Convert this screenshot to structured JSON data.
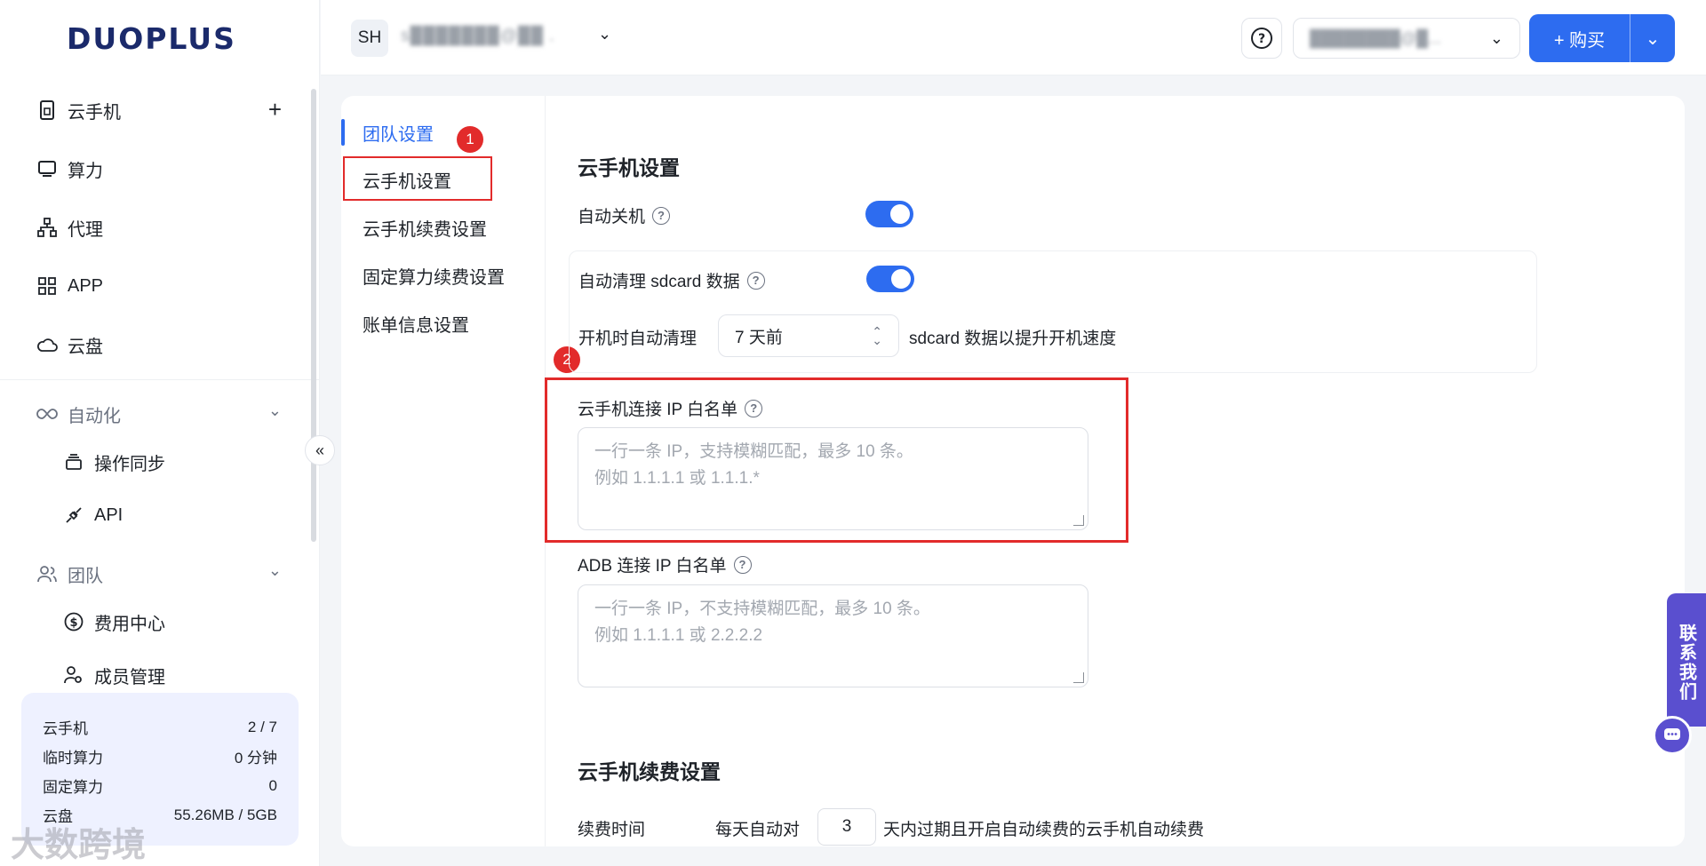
{
  "app": {
    "logo": "DUOPLUS"
  },
  "sidebar": {
    "items": [
      {
        "label": "云手机",
        "icon": "phone-icon"
      },
      {
        "label": "算力",
        "icon": "monitor-icon"
      },
      {
        "label": "代理",
        "icon": "network-icon"
      },
      {
        "label": "APP",
        "icon": "grid-icon"
      },
      {
        "label": "云盘",
        "icon": "cloud-icon"
      }
    ],
    "groups": [
      {
        "label": "自动化",
        "children": [
          {
            "label": "操作同步"
          },
          {
            "label": "API"
          }
        ]
      },
      {
        "label": "团队",
        "children": [
          {
            "label": "费用中心"
          },
          {
            "label": "成员管理"
          }
        ]
      }
    ],
    "stats": [
      {
        "label": "云手机",
        "value": "2 / 7"
      },
      {
        "label": "临时算力",
        "value": "0 分钟"
      },
      {
        "label": "固定算力",
        "value": "0"
      },
      {
        "label": "云盘",
        "value": "55.26MB / 5GB"
      }
    ]
  },
  "watermark": "大数跨境",
  "header": {
    "avatar": "SH",
    "account": "s███████@██ .",
    "user": "████████@█...",
    "buy_label": "+ 购买"
  },
  "subnav": {
    "items": [
      "团队设置",
      "云手机设置",
      "云手机续费设置",
      "固定算力续费设置",
      "账单信息设置"
    ]
  },
  "badges": [
    "1",
    "2"
  ],
  "settings": {
    "section_title": "云手机设置",
    "auto_shutdown": {
      "label": "自动关机",
      "enabled": true
    },
    "auto_clean": {
      "label": "自动清理 sdcard 数据",
      "enabled": true
    },
    "clean_prefix": "开机时自动清理",
    "clean_select": "7 天前",
    "clean_suffix": "sdcard 数据以提升开机速度",
    "ip_whitelist": {
      "label": "云手机连接 IP 白名单",
      "placeholder_line1": "一行一条 IP，支持模糊匹配，最多 10 条。",
      "placeholder_line2": "例如 1.1.1.1 或 1.1.1.*"
    },
    "adb_whitelist": {
      "label": "ADB 连接 IP 白名单",
      "placeholder_line1": "一行一条 IP，不支持模糊匹配，最多 10 条。",
      "placeholder_line2": "例如 1.1.1.1 或 2.2.2.2"
    },
    "renew_section_title": "云手机续费设置",
    "renew_label": "续费时间",
    "renew_prefix": "每天自动对",
    "renew_days": "3",
    "renew_suffix": "天内过期且开启自动续费的云手机自动续费"
  },
  "contact": {
    "label": "联系我们"
  },
  "colors": {
    "accent": "#2d6cf0",
    "annotation": "#e22b2b",
    "contact": "#5a4fcf"
  }
}
